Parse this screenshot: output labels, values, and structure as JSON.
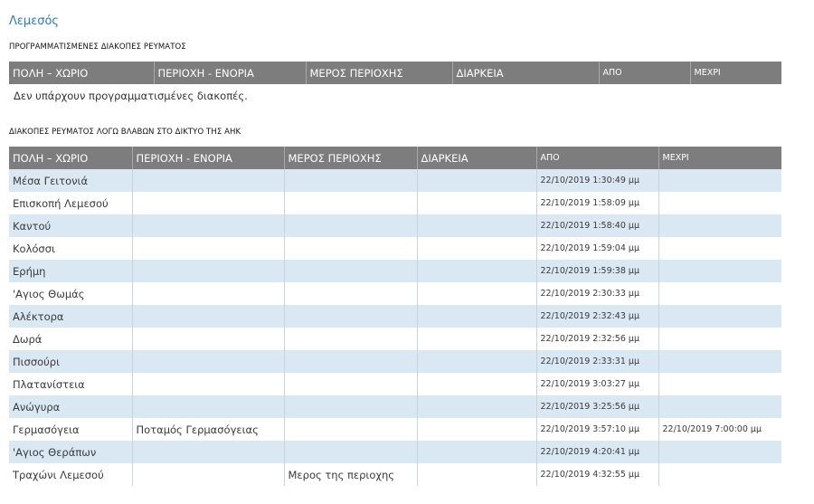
{
  "region_title": "Λεμεσός",
  "planned": {
    "heading": "ΠΡΟΓΡΑΜΜΑΤΙΣΜΕΝΕΣ ΔΙΑΚΟΠΕΣ ΡΕΥΜΑΤΟΣ",
    "columns": [
      "ΠΟΛΗ – ΧΩΡΙΟ",
      "ΠΕΡΙΟΧΗ - ΕΝΟΡΙΑ",
      "ΜΕΡΟΣ ΠΕΡΙΟΧΗΣ",
      "ΔΙΑΡΚΕΙΑ",
      "ΑΠΟ",
      "ΜΕΧΡΙ"
    ],
    "empty_message": "Δεν υπάρχουν προγραμματισμένες διακοπές."
  },
  "faults": {
    "heading": "ΔΙΑΚΟΠΕΣ ΡΕΥΜΑΤΟΣ ΛΟΓΩ ΒΛΑΒΩΝ ΣΤΟ ΔΙΚΤΥΟ ΤΗΣ ΑΗΚ",
    "columns": [
      "ΠΟΛΗ – ΧΩΡΙΟ",
      "ΠΕΡΙΟΧΗ - ΕΝΟΡΙΑ",
      "ΜΕΡΟΣ ΠΕΡΙΟΧΗΣ",
      "ΔΙΑΡΚΕΙΑ",
      "ΑΠΟ",
      "ΜΕΧΡΙ"
    ],
    "rows": [
      [
        "Μέσα Γειτονιά",
        "",
        "",
        "",
        "22/10/2019 1:30:49 μμ",
        ""
      ],
      [
        "Επισκοπή Λεμεσού",
        "",
        "",
        "",
        "22/10/2019 1:58:09 μμ",
        ""
      ],
      [
        "Καντού",
        "",
        "",
        "",
        "22/10/2019 1:58:40 μμ",
        ""
      ],
      [
        "Κολόσσι",
        "",
        "",
        "",
        "22/10/2019 1:59:04 μμ",
        ""
      ],
      [
        "Ερήμη",
        "",
        "",
        "",
        "22/10/2019 1:59:38 μμ",
        ""
      ],
      [
        "'Αγιος Θωμάς",
        "",
        "",
        "",
        "22/10/2019 2:30:33 μμ",
        ""
      ],
      [
        "Αλέκτορα",
        "",
        "",
        "",
        "22/10/2019 2:32:43 μμ",
        ""
      ],
      [
        "Δωρά",
        "",
        "",
        "",
        "22/10/2019 2:32:56 μμ",
        ""
      ],
      [
        "Πισσούρι",
        "",
        "",
        "",
        "22/10/2019 2:33:31 μμ",
        ""
      ],
      [
        "Πλατανίστεια",
        "",
        "",
        "",
        "22/10/2019 3:03:27 μμ",
        ""
      ],
      [
        "Ανώγυρα",
        "",
        "",
        "",
        "22/10/2019 3:25:56 μμ",
        ""
      ],
      [
        "Γερμασόγεια",
        "Ποταμός Γερμασόγειας",
        "",
        "",
        "22/10/2019 3:57:10 μμ",
        "22/10/2019 7:00:00 μμ"
      ],
      [
        "'Αγιος Θεράπων",
        "",
        "",
        "",
        "22/10/2019 4:20:41 μμ",
        ""
      ],
      [
        "Τραχώνι Λεμεσού",
        "",
        "Μερος της περιοχης",
        "",
        "22/10/2019 4:32:55 μμ",
        ""
      ]
    ]
  }
}
